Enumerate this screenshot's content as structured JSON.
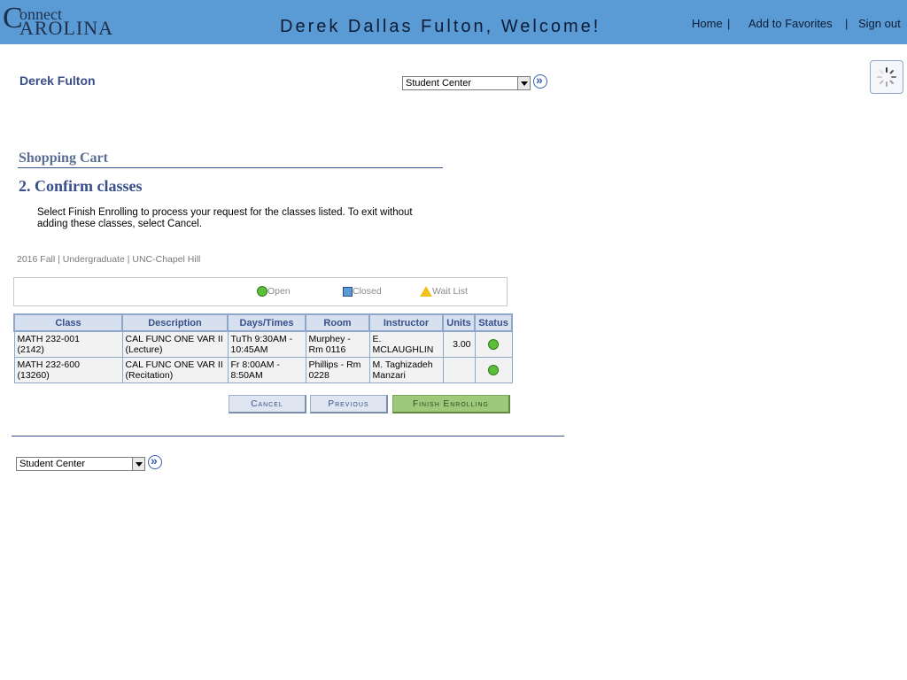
{
  "header": {
    "logo": {
      "brand": "Connect Carolina",
      "line1_cap": "C",
      "line1_rest": "onnect",
      "line2": "AROLINA"
    },
    "welcome": "Derek Dallas Fulton, Welcome!",
    "links": {
      "home": "Home",
      "favorites": "Add to Favorites",
      "signout": "Sign out",
      "separator": "|"
    }
  },
  "user": {
    "name": "Derek Fulton"
  },
  "nav_select": {
    "top_value": "Student Center",
    "bottom_value": "Student Center"
  },
  "page": {
    "section_title": "Shopping Cart",
    "step_title": "2.  Confirm classes",
    "instructions": "Select Finish Enrolling to process your request for the classes listed. To exit without adding these classes, select Cancel.",
    "term": "2016 Fall | Undergraduate | UNC-Chapel Hill"
  },
  "legend": {
    "open": "Open",
    "closed": "Closed",
    "waitlist": "Wait List"
  },
  "table": {
    "headers": {
      "class": "Class",
      "description": "Description",
      "days_times": "Days/Times",
      "room": "Room",
      "instructor": "Instructor",
      "units": "Units",
      "status": "Status"
    },
    "rows": [
      {
        "class_line1": "MATH 232-001",
        "class_line2": "(2142)",
        "desc_line1": "CAL FUNC ONE VAR II",
        "desc_line2": "(Lecture)",
        "days_line1": "TuTh 9:30AM -",
        "days_line2": "10:45AM",
        "room_line1": "Murphey -",
        "room_line2": "Rm 0116",
        "instr_line1": "E.",
        "instr_line2": "MCLAUGHLIN",
        "units": "3.00",
        "status": "open"
      },
      {
        "class_line1": "MATH 232-600",
        "class_line2": "(13260)",
        "desc_line1": "CAL FUNC ONE VAR II",
        "desc_line2": "(Recitation)",
        "days_line1": "Fr 8:00AM -",
        "days_line2": "8:50AM",
        "room_line1": "Phillips - Rm",
        "room_line2": "0228",
        "instr_line1": "M. Taghizadeh",
        "instr_line2": "Manzari",
        "units": "",
        "status": "open"
      }
    ]
  },
  "buttons": {
    "cancel": "Cancel",
    "previous": "Previous",
    "finish": "Finish Enrolling"
  },
  "colors": {
    "banner": "#5b9bd5",
    "accent": "#3a4f8a",
    "open_status": "#5cbf3a",
    "finish_button": "#9ec97a"
  }
}
